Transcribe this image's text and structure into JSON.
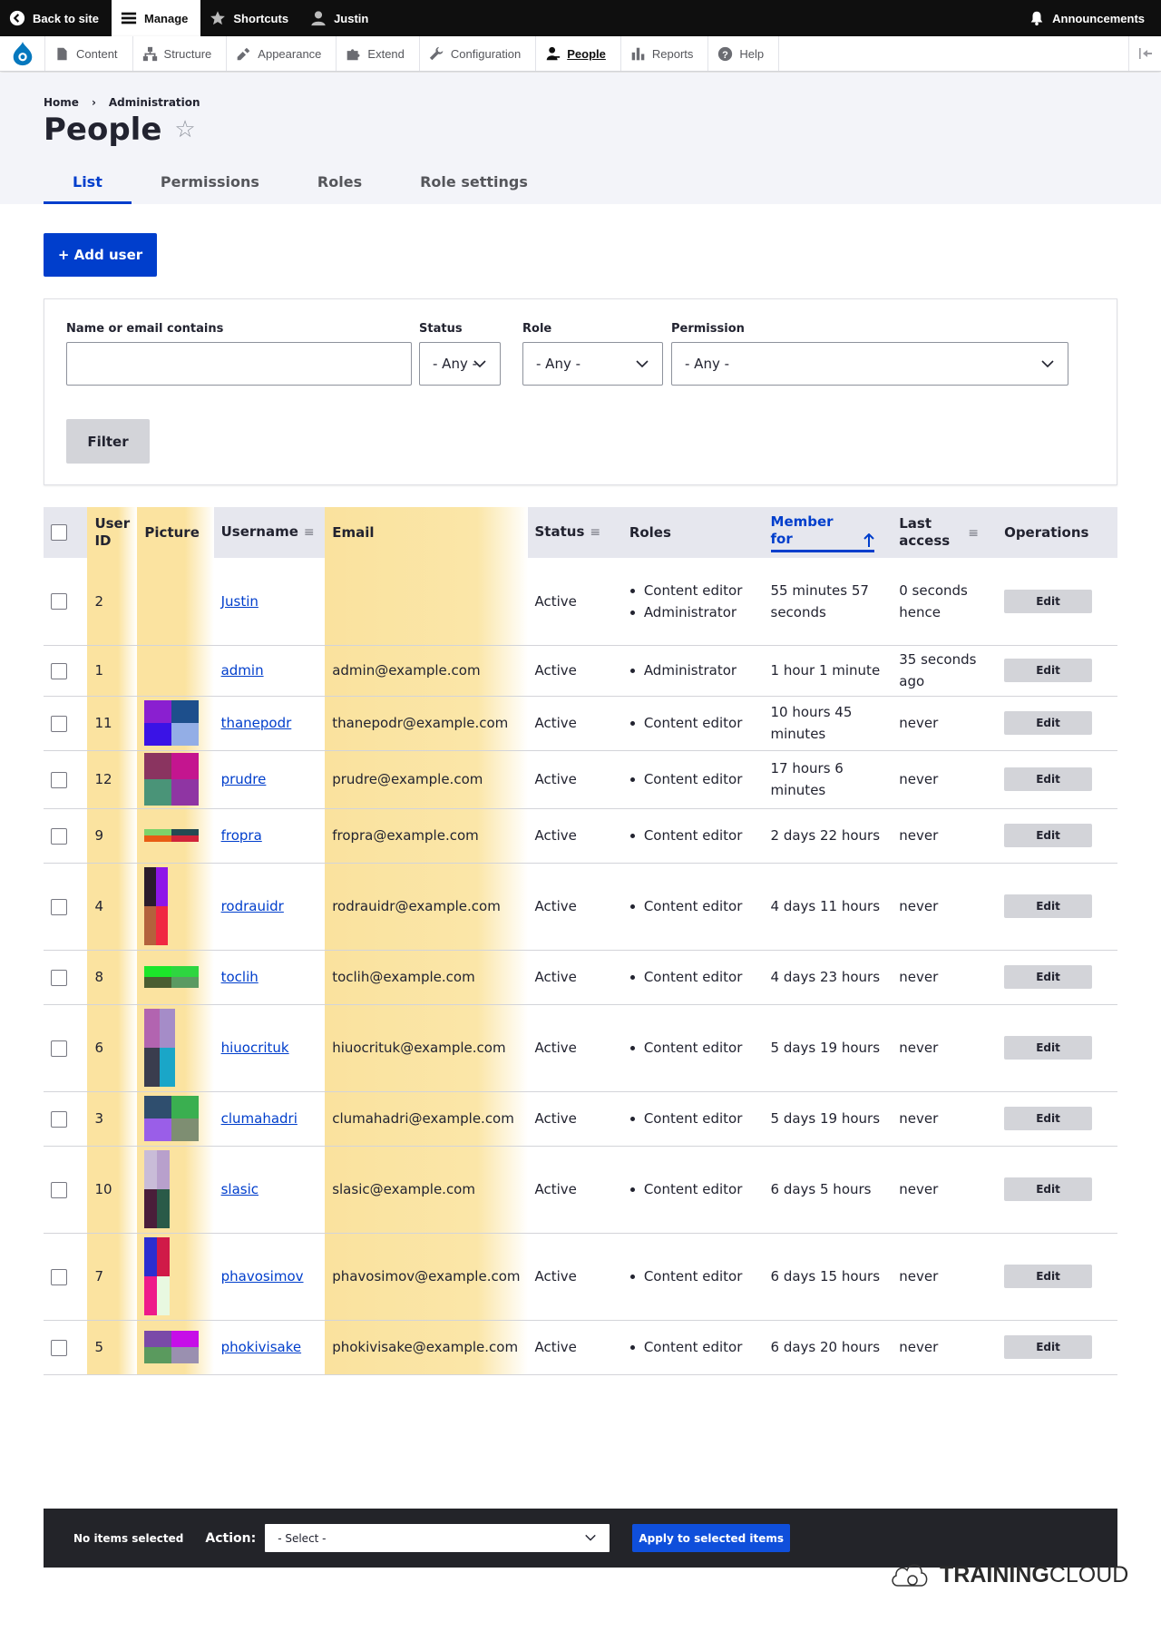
{
  "toolbar": {
    "back": "Back to site",
    "manage": "Manage",
    "shortcuts": "Shortcuts",
    "user": "Justin",
    "announcements": "Announcements"
  },
  "menu": {
    "items": [
      {
        "label": "Content",
        "icon": "content-icon"
      },
      {
        "label": "Structure",
        "icon": "structure-icon"
      },
      {
        "label": "Appearance",
        "icon": "appearance-icon"
      },
      {
        "label": "Extend",
        "icon": "extend-icon"
      },
      {
        "label": "Configuration",
        "icon": "configuration-icon"
      },
      {
        "label": "People",
        "icon": "people-icon",
        "active": true
      },
      {
        "label": "Reports",
        "icon": "reports-icon"
      },
      {
        "label": "Help",
        "icon": "help-icon"
      }
    ]
  },
  "breadcrumb": {
    "home": "Home",
    "sep": "›",
    "current": "Administration"
  },
  "page": {
    "title": "People",
    "star": "☆"
  },
  "tabs": [
    "List",
    "Permissions",
    "Roles",
    "Role settings"
  ],
  "add_user": "+ Add user",
  "filters": {
    "name_label": "Name or email contains",
    "name_value": "",
    "status_label": "Status",
    "status_value": "- Any -",
    "role_label": "Role",
    "role_value": "- Any -",
    "permission_label": "Permission",
    "permission_value": "- Any -",
    "filter_button": "Filter"
  },
  "table": {
    "headers": {
      "uid": "User ID",
      "picture": "Picture",
      "username": "Username",
      "email": "Email",
      "status": "Status",
      "roles": "Roles",
      "member_for": "Member for",
      "last_access": "Last access",
      "operations": "Operations"
    },
    "edit_label": "Edit",
    "rows": [
      {
        "uid": "2",
        "username": "Justin",
        "email": "",
        "status": "Active",
        "roles": [
          "Content editor",
          "Administrator"
        ],
        "member": "55 minutes 57 seconds",
        "last": "0 seconds hence",
        "pic": []
      },
      {
        "uid": "1",
        "username": "admin",
        "email": "admin@example.com",
        "status": "Active",
        "roles": [
          "Administrator"
        ],
        "member": "1 hour 1 minute",
        "last": "35 seconds ago",
        "pic": []
      },
      {
        "uid": "11",
        "username": "thanepodr",
        "email": "thanepodr@example.com",
        "status": "Active",
        "roles": [
          "Content editor"
        ],
        "member": "10 hours 45 minutes",
        "last": "never",
        "pic": [
          "#8a1fd0",
          "#1d4f8c",
          "#3a13e6",
          "#93aee6"
        ]
      },
      {
        "uid": "12",
        "username": "prudre",
        "email": "prudre@example.com",
        "status": "Active",
        "roles": [
          "Content editor"
        ],
        "member": "17 hours 6 minutes",
        "last": "never",
        "pic": [
          "#8a3460",
          "#c4158f",
          "#4a9478",
          "#8f35a3"
        ]
      },
      {
        "uid": "9",
        "username": "fropra",
        "email": "fropra@example.com",
        "status": "Active",
        "roles": [
          "Content editor"
        ],
        "member": "2 days 22 hours",
        "last": "never",
        "pic": [
          "#7dd26a",
          "#244a52",
          "#e85c14",
          "#d1243a"
        ]
      },
      {
        "uid": "4",
        "username": "rodrauidr",
        "email": "rodrauidr@example.com",
        "status": "Active",
        "roles": [
          "Content editor"
        ],
        "member": "4 days 11 hours",
        "last": "never",
        "pic": [
          "#2b1c2c",
          "#8e16e8",
          "#b3623c",
          "#f02842"
        ]
      },
      {
        "uid": "8",
        "username": "toclih",
        "email": "toclih@example.com",
        "status": "Active",
        "roles": [
          "Content editor"
        ],
        "member": "4 days 23 hours",
        "last": "never",
        "pic": [
          "#1ce62a",
          "#2ed640",
          "#4a5e32",
          "#5a9a62"
        ]
      },
      {
        "uid": "6",
        "username": "hiuocrituk",
        "email": "hiuocrituk@example.com",
        "status": "Active",
        "roles": [
          "Content editor"
        ],
        "member": "5 days 19 hours",
        "last": "never",
        "pic": [
          "#b264b0",
          "#a58cc8",
          "#3a3d4e",
          "#1aa6c8"
        ]
      },
      {
        "uid": "3",
        "username": "clumahadri",
        "email": "clumahadri@example.com",
        "status": "Active",
        "roles": [
          "Content editor"
        ],
        "member": "5 days 19 hours",
        "last": "never",
        "pic": [
          "#2f4e6e",
          "#3aaf50",
          "#9a5ee8",
          "#7e8e72"
        ]
      },
      {
        "uid": "10",
        "username": "slasic",
        "email": "slasic@example.com",
        "status": "Active",
        "roles": [
          "Content editor"
        ],
        "member": "6 days 5 hours",
        "last": "never",
        "pic": [
          "#c9bcd8",
          "#b8a0cc",
          "#4a1e3a",
          "#2a5a48"
        ]
      },
      {
        "uid": "7",
        "username": "phavosimov",
        "email": "phavosimov@example.com",
        "status": "Active",
        "roles": [
          "Content editor"
        ],
        "member": "6 days 15 hours",
        "last": "never",
        "pic": [
          "#2a2ed0",
          "#d01a48",
          "#ee1a8a",
          "#e8f8e0"
        ]
      },
      {
        "uid": "5",
        "username": "phokivisake",
        "email": "phokivisake@example.com",
        "status": "Active",
        "roles": [
          "Content editor"
        ],
        "member": "6 days 20 hours",
        "last": "never",
        "pic": [
          "#7a4aa8",
          "#c60ee8",
          "#5a9a5e",
          "#9a90b0"
        ]
      }
    ]
  },
  "bulk": {
    "selected": "No items selected",
    "action_label": "Action:",
    "select_value": "- Select -",
    "apply": "Apply to selected items"
  },
  "brand": {
    "bold": "TRAINING",
    "rest": "CLOUD"
  }
}
